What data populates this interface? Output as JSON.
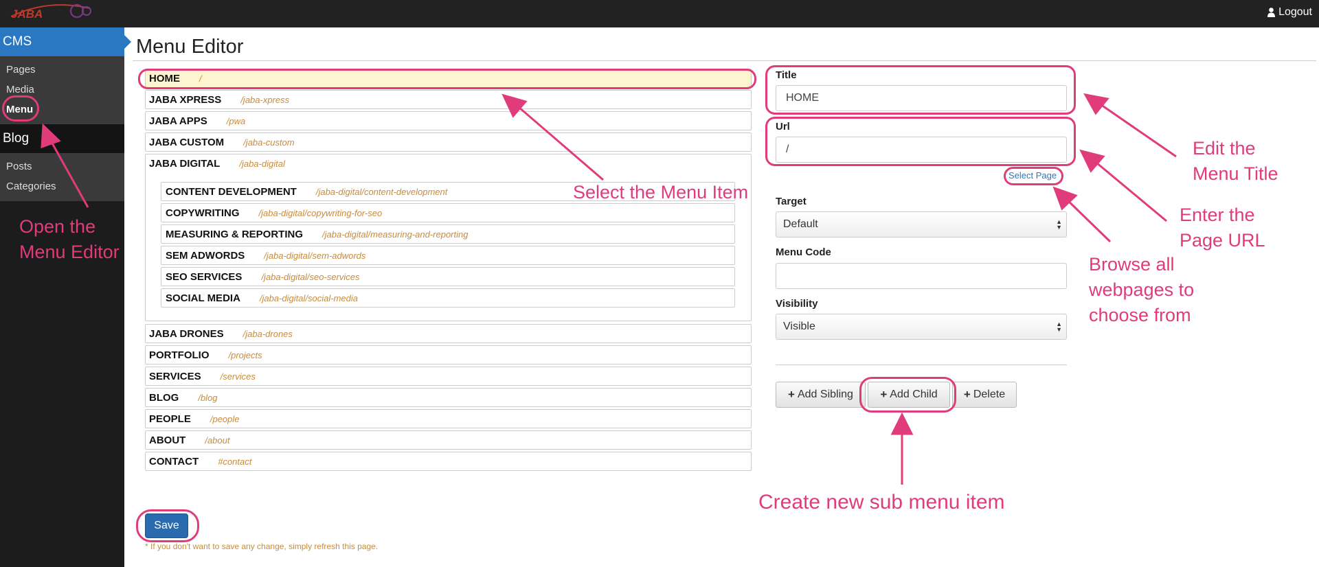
{
  "app": {
    "logo_text": "JABA",
    "logout_label": "Logout"
  },
  "sidebar": {
    "cms_label": "CMS",
    "cms_items": [
      {
        "label": "Pages"
      },
      {
        "label": "Media"
      },
      {
        "label": "Menu",
        "active": true
      }
    ],
    "blog_label": "Blog",
    "blog_items": [
      {
        "label": "Posts"
      },
      {
        "label": "Categories"
      }
    ]
  },
  "main": {
    "title": "Menu Editor",
    "menu_items": [
      {
        "name": "HOME",
        "url": "/",
        "selected": true
      },
      {
        "name": "JABA XPRESS",
        "url": "/jaba-xpress"
      },
      {
        "name": "JABA APPS",
        "url": "/pwa"
      },
      {
        "name": "JABA CUSTOM",
        "url": "/jaba-custom"
      },
      {
        "name": "JABA DIGITAL",
        "url": "/jaba-digital",
        "children": [
          {
            "name": "CONTENT DEVELOPMENT",
            "url": "/jaba-digital/content-development"
          },
          {
            "name": "COPYWRITING",
            "url": "/jaba-digital/copywriting-for-seo"
          },
          {
            "name": "MEASURING & REPORTING",
            "url": "/jaba-digital/measuring-and-reporting"
          },
          {
            "name": "SEM ADWORDS",
            "url": "/jaba-digital/sem-adwords"
          },
          {
            "name": "SEO SERVICES",
            "url": "/jaba-digital/seo-services"
          },
          {
            "name": "SOCIAL MEDIA",
            "url": "/jaba-digital/social-media"
          }
        ]
      },
      {
        "name": "JABA DRONES",
        "url": "/jaba-drones"
      },
      {
        "name": "PORTFOLIO",
        "url": "/projects"
      },
      {
        "name": "SERVICES",
        "url": "/services"
      },
      {
        "name": "BLOG",
        "url": "/blog"
      },
      {
        "name": "PEOPLE",
        "url": "/people"
      },
      {
        "name": "ABOUT",
        "url": "/about"
      },
      {
        "name": "CONTACT",
        "url": "#contact"
      }
    ],
    "save_label": "Save",
    "save_note": "* If you don't want to save any change, simply refresh this page."
  },
  "form": {
    "title_label": "Title",
    "title_value": "HOME",
    "url_label": "Url",
    "url_value": "/",
    "select_page_label": "Select Page",
    "target_label": "Target",
    "target_value": "Default",
    "menu_code_label": "Menu Code",
    "menu_code_value": "",
    "visibility_label": "Visibility",
    "visibility_value": "Visible",
    "add_sibling_label": "Add Sibling",
    "add_child_label": "Add Child",
    "delete_label": "Delete"
  },
  "annotations": {
    "open_menu_editor": [
      "Open the",
      "Menu Editor"
    ],
    "select_menu_item": "Select the Menu Item",
    "edit_menu_title": [
      "Edit the",
      "Menu Title"
    ],
    "enter_page_url": [
      "Enter the",
      "Page URL"
    ],
    "browse_webpages": [
      "Browse all",
      "webpages to",
      "choose from"
    ],
    "create_sub_menu": "Create new sub menu item"
  },
  "colors": {
    "accent": "#2a78c2",
    "annotation": "#e03b7a",
    "url_text": "#c98b3b",
    "selected_row": "#fdf5cf"
  }
}
